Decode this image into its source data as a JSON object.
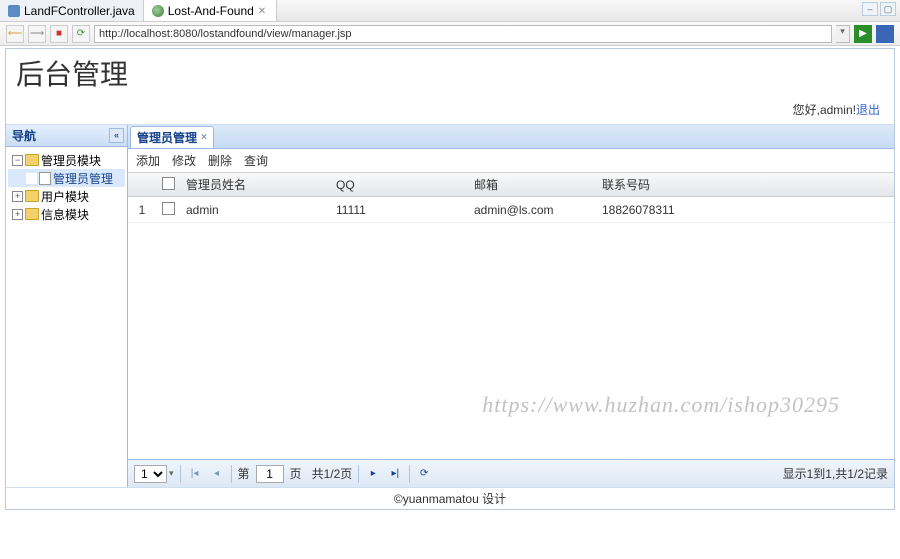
{
  "editor_tabs": [
    {
      "label": "LandFController.java",
      "icon": "java",
      "close": false
    },
    {
      "label": "Lost-And-Found",
      "icon": "web",
      "close": true
    }
  ],
  "url": "http://localhost:8080/lostandfound/view/manager.jsp",
  "page_title": "后台管理",
  "greeting": {
    "prefix": "您好,",
    "user": "admin",
    "logout": "退出"
  },
  "nav_panel": {
    "title": "导航",
    "tree": [
      {
        "label": "管理员模块",
        "type": "folder",
        "expanded": true,
        "depth": 0
      },
      {
        "label": "管理员管理",
        "type": "file",
        "depth": 1,
        "selected": true
      },
      {
        "label": "用户模块",
        "type": "folder",
        "expanded": false,
        "depth": 0
      },
      {
        "label": "信息模块",
        "type": "folder",
        "expanded": false,
        "depth": 0
      }
    ]
  },
  "main_tab": {
    "label": "管理员管理"
  },
  "actions": {
    "add": "添加",
    "edit": "修改",
    "delete": "删除",
    "search": "查询"
  },
  "grid": {
    "columns": {
      "name": "管理员姓名",
      "qq": "QQ",
      "email": "邮箱",
      "phone": "联系号码"
    },
    "rows": [
      {
        "num": "1",
        "name": "admin",
        "qq": "11111",
        "email": "admin@ls.com",
        "phone": "18826078311"
      }
    ]
  },
  "pager": {
    "page_size_value": "1",
    "page_label_prefix": "第",
    "page_value": "1",
    "page_label_suffix": "页",
    "total_pages": "共1/2页",
    "info": "显示1到1,共1/2记录"
  },
  "footer": "©yuanmamatou 设计",
  "watermark": "https://www.huzhan.com/ishop30295"
}
